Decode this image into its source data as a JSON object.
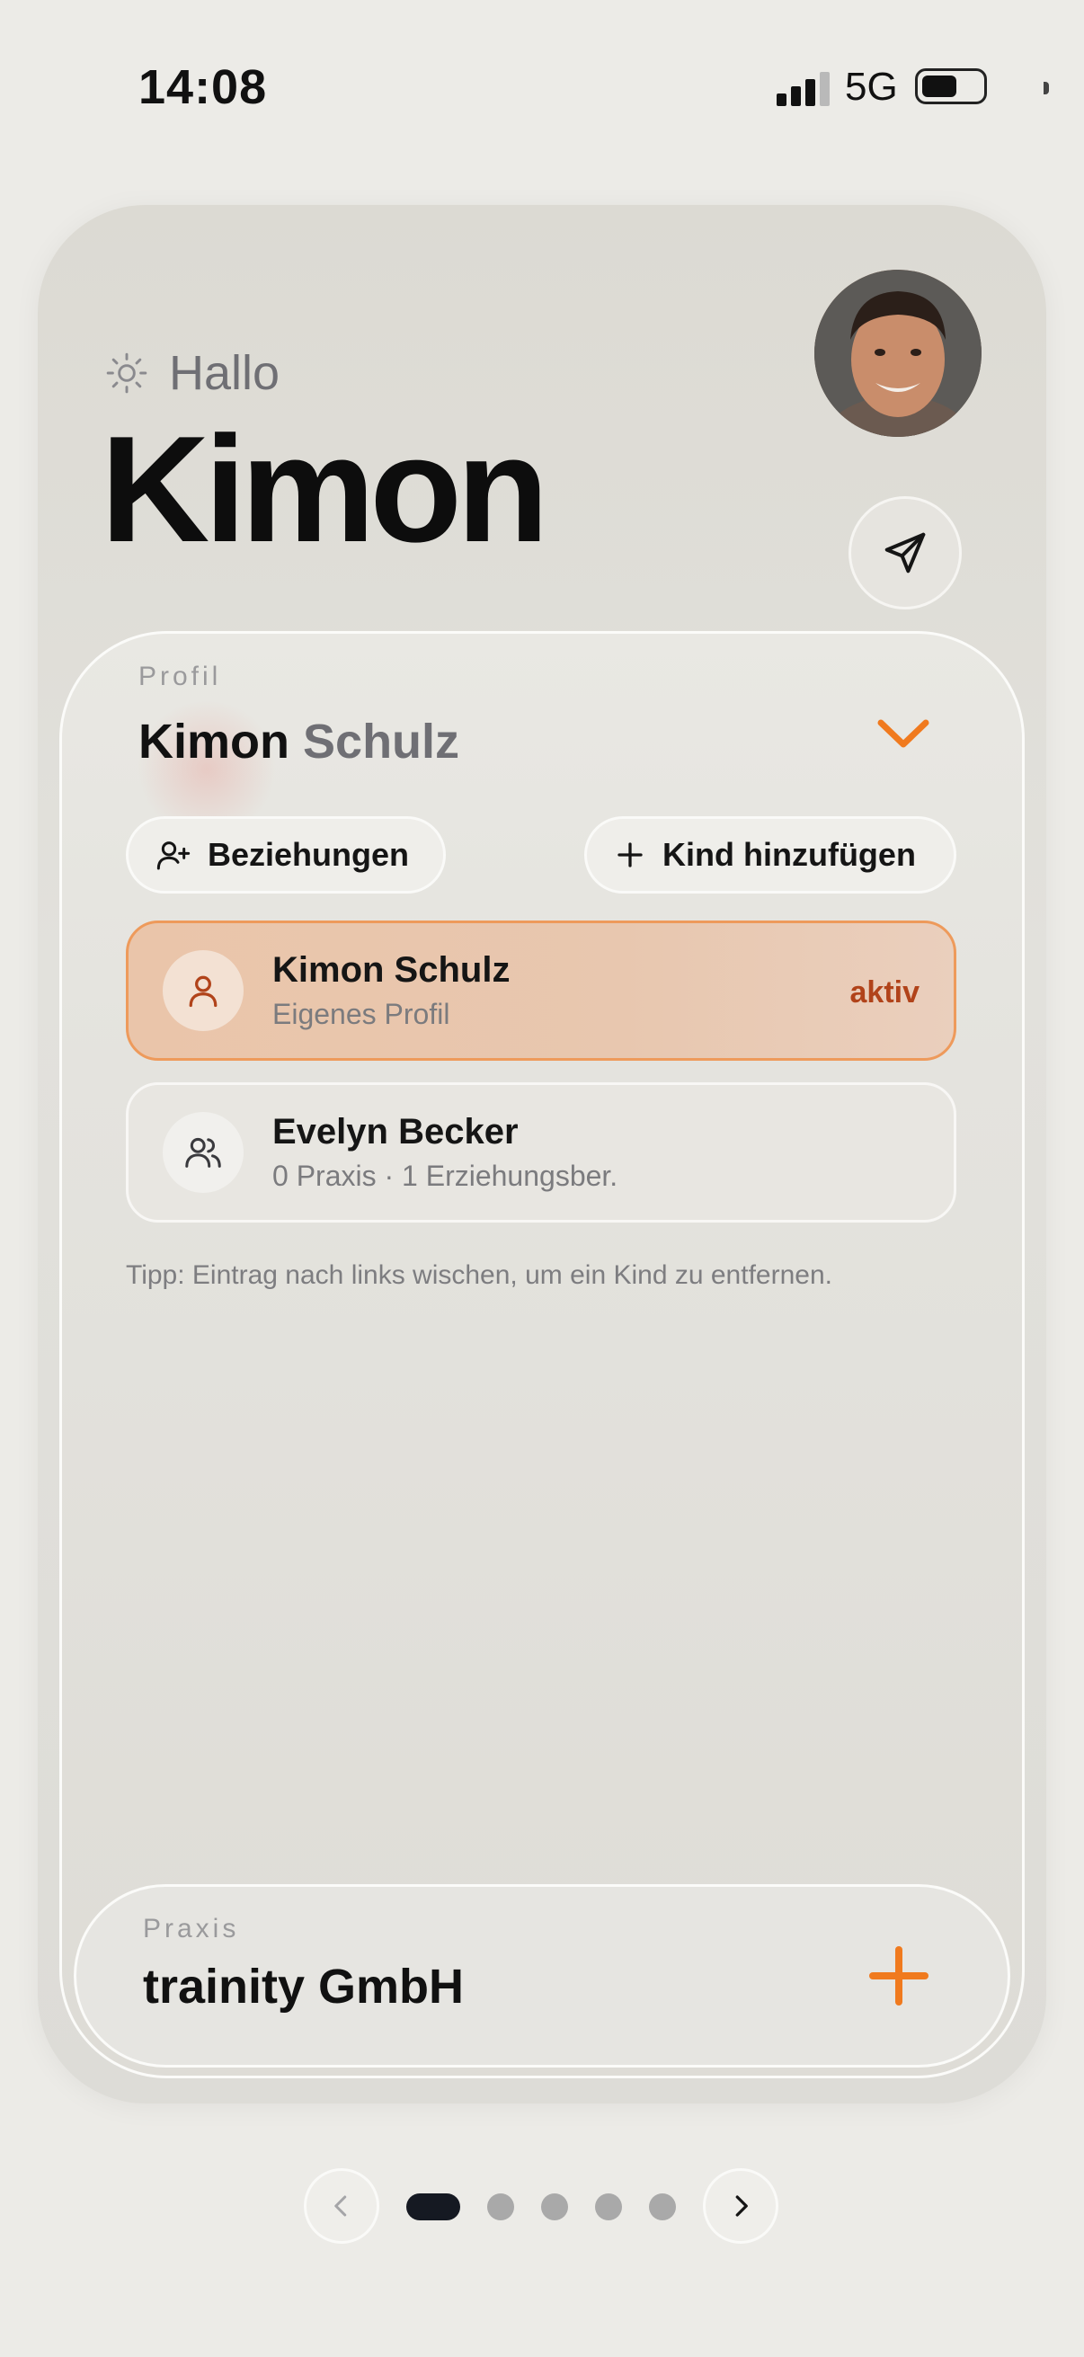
{
  "status_bar": {
    "time": "14:08",
    "network": "5G"
  },
  "header": {
    "greeting": "Hallo",
    "name": "Kimon"
  },
  "profile": {
    "label": "Profil",
    "first_name": "Kimon",
    "last_name": "Schulz",
    "relations_button": "Beziehungen",
    "add_child_button": "Kind hinzufügen",
    "entries": [
      {
        "name": "Kimon Schulz",
        "subtitle": "Eigenes Profil",
        "badge": "aktiv",
        "icon": "user-icon"
      },
      {
        "name": "Evelyn Becker",
        "subtitle": "0 Praxis · 1 Erziehungsber.",
        "icon": "users-icon"
      }
    ],
    "tip": "Tipp: Eintrag nach links wischen, um ein Kind zu entfernen."
  },
  "praxis": {
    "label": "Praxis",
    "name": "trainity GmbH"
  },
  "pager": {
    "pages": 5,
    "current": 1
  },
  "colors": {
    "accent": "#f07a1e",
    "active_row_border": "#ee9a5b",
    "badge": "#b1431a",
    "background": "#ecebe7"
  }
}
